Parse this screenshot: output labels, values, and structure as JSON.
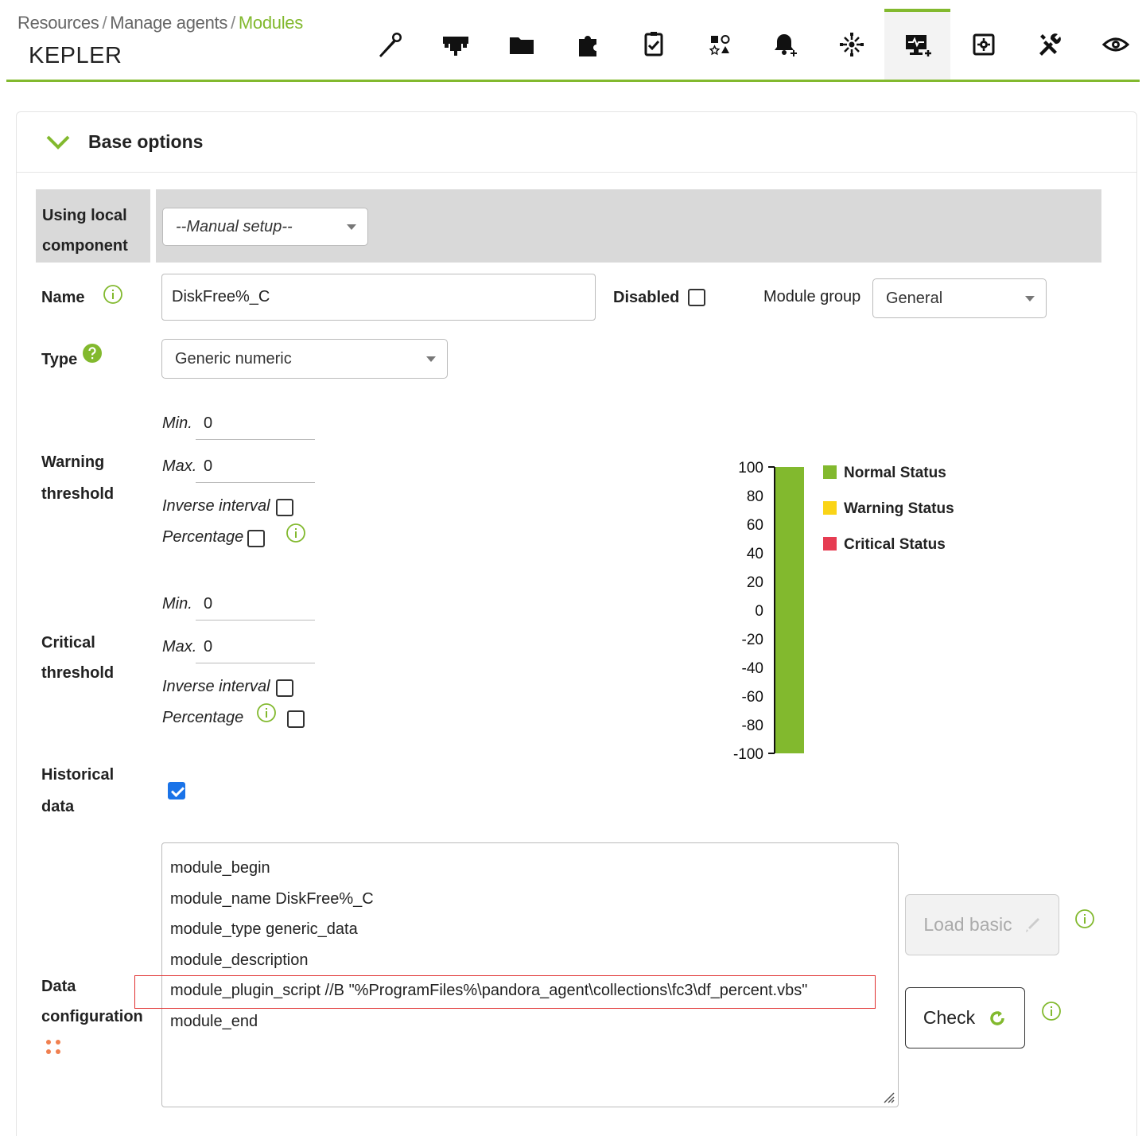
{
  "breadcrumb": {
    "items": [
      "Resources",
      "Manage agents"
    ],
    "current": "Modules",
    "separator": "/"
  },
  "agent_name": "KEPLER",
  "tabs": [
    {
      "icon": "wrench-icon",
      "active": false
    },
    {
      "icon": "network-icon",
      "active": false
    },
    {
      "icon": "folder-icon",
      "active": false
    },
    {
      "icon": "puzzle-icon",
      "active": false
    },
    {
      "icon": "checklist-icon",
      "active": false
    },
    {
      "icon": "shapes-icon",
      "active": false
    },
    {
      "icon": "bell-plus-icon",
      "active": false
    },
    {
      "icon": "cluster-icon",
      "active": false
    },
    {
      "icon": "monitor-plus-icon",
      "active": true
    },
    {
      "icon": "gear-box-icon",
      "active": false
    },
    {
      "icon": "tools-icon",
      "active": false
    },
    {
      "icon": "eye-icon",
      "active": false
    }
  ],
  "panel": {
    "title": "Base options"
  },
  "local_component": {
    "label_line1": "Using local",
    "label_line2": "component",
    "select_value": "--Manual setup--"
  },
  "name_field": {
    "label": "Name",
    "value": "DiskFree%_C"
  },
  "disabled": {
    "label": "Disabled",
    "checked": false
  },
  "module_group": {
    "label": "Module group",
    "value": "General"
  },
  "type_field": {
    "label": "Type",
    "value": "Generic numeric"
  },
  "warning_threshold": {
    "label_line1": "Warning",
    "label_line2": "threshold",
    "min_label": "Min.",
    "min_value": "0",
    "max_label": "Max.",
    "max_value": "0",
    "inverse_label": "Inverse interval",
    "inverse_checked": false,
    "percentage_label": "Percentage",
    "percentage_checked": false
  },
  "critical_threshold": {
    "label_line1": "Critical",
    "label_line2": "threshold",
    "min_label": "Min.",
    "min_value": "0",
    "max_label": "Max.",
    "max_value": "0",
    "inverse_label": "Inverse interval",
    "inverse_checked": false,
    "percentage_label": "Percentage",
    "percentage_checked": false
  },
  "historical_data": {
    "label_line1": "Historical",
    "label_line2": "data",
    "checked": true
  },
  "data_configuration": {
    "label_line1": "Data",
    "label_line2": "configuration",
    "lines": [
      "module_begin",
      "module_name DiskFree%_C",
      "module_type generic_data",
      "module_description",
      "module_plugin_script //B \"%ProgramFiles%\\pandora_agent\\collections\\fc3\\df_percent.vbs\"",
      "module_end"
    ],
    "highlighted_line_index": 4
  },
  "buttons": {
    "load_basic": "Load basic",
    "check": "Check"
  },
  "colors": {
    "accent": "#82b92e",
    "normal": "#82b92e",
    "warning": "#fad417",
    "critical": "#e63c52",
    "highlight_border": "#e03030"
  },
  "chart_data": {
    "type": "bar",
    "title": "",
    "ylim": [
      -100,
      100
    ],
    "y_ticks": [
      "100",
      "80",
      "60",
      "40",
      "20",
      "0",
      "-20",
      "-40",
      "-60",
      "-80",
      "-100"
    ],
    "bands": [
      {
        "status": "normal",
        "from": -100,
        "to": 100
      }
    ],
    "legend": [
      {
        "name": "Normal Status",
        "color": "#82b92e"
      },
      {
        "name": "Warning Status",
        "color": "#fad417"
      },
      {
        "name": "Critical Status",
        "color": "#e63c52"
      }
    ],
    "legend_position": "right"
  }
}
